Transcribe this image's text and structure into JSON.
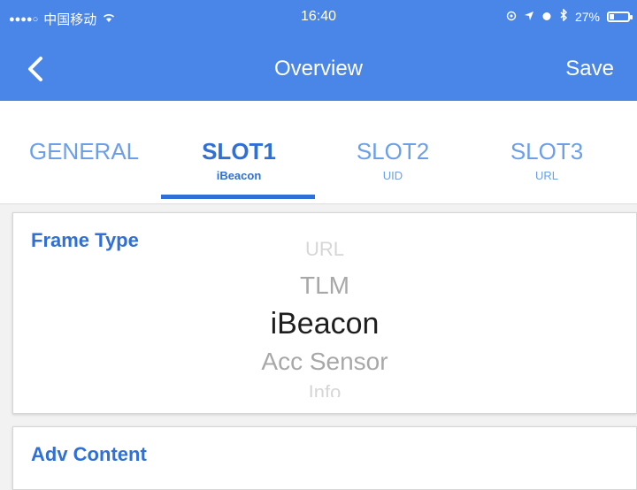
{
  "status_bar": {
    "carrier": "中国移动",
    "time": "16:40",
    "battery_text": "27%",
    "battery_level": 0.27
  },
  "nav": {
    "back_icon": "chevron-left-icon",
    "title": "Overview",
    "save_label": "Save"
  },
  "tabs": [
    {
      "label": "GENERAL",
      "sub": ""
    },
    {
      "label": "SLOT1",
      "sub": "iBeacon"
    },
    {
      "label": "SLOT2",
      "sub": "UID"
    },
    {
      "label": "SLOT3",
      "sub": "URL"
    }
  ],
  "active_tab": 1,
  "frame_type": {
    "title": "Frame Type",
    "options": [
      "URL",
      "TLM",
      "iBeacon",
      "Acc Sensor",
      "Info"
    ],
    "selected": "iBeacon"
  },
  "adv_content": {
    "title": "Adv Content"
  },
  "colors": {
    "accent": "#4a86e8",
    "accent_dark": "#2f6fd6"
  }
}
